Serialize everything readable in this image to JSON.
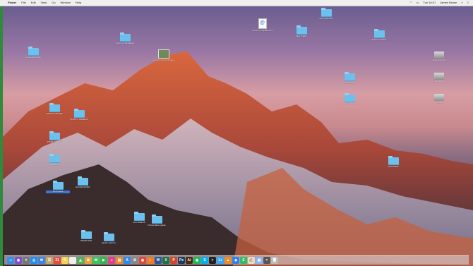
{
  "menubar": {
    "app_name": "Finder",
    "menus": [
      "File",
      "Edit",
      "View",
      "Go",
      "Window",
      "Help"
    ],
    "clock": "Tue 18:07",
    "user": "James Brown"
  },
  "desktop_icons": [
    {
      "kind": "folder",
      "label": "Forms & Templates",
      "color": "#6cc0ee"
    },
    {
      "kind": "folder",
      "label": "Household Files",
      "color": "#6cc0ee"
    },
    {
      "kind": "doc",
      "label": "Lincoln Centre Screen",
      "color": "#ffffff"
    },
    {
      "kind": "web",
      "label": "invoice_template.html",
      "color": "#ffffff"
    },
    {
      "kind": "folder",
      "label": "New Folder",
      "color": "#6cc0ee"
    },
    {
      "kind": "folder",
      "label": "App resources",
      "color": "#6cc0ee"
    },
    {
      "kind": "folder",
      "label": "Images & Ideas",
      "color": "#6cc0ee"
    },
    {
      "kind": "folder",
      "label": "TOOLKIT AS PDF",
      "color": "#6cc0ee"
    },
    {
      "kind": "folder",
      "label": "SUPPLY ORDERS",
      "color": "#6cc0ee"
    },
    {
      "kind": "folder",
      "label": "PRINT AS PDF",
      "color": "#6cc0ee"
    },
    {
      "kind": "folder",
      "label": "Websites",
      "color": "#6cc0ee"
    },
    {
      "kind": "folder",
      "label": "Workspace",
      "color": "#6cc0ee"
    },
    {
      "kind": "folder",
      "label": "ALCOHOLISM",
      "color": "#6cc0ee"
    },
    {
      "kind": "folder",
      "label": "GUI VIDEOS",
      "color": "#6cc0ee"
    },
    {
      "kind": "folder",
      "label": "Presentation guide",
      "color": "#6cc0ee"
    },
    {
      "kind": "folder",
      "label": "PROM DAD",
      "color": "#6cc0ee"
    },
    {
      "kind": "folder",
      "label": "garden planner",
      "color": "#6cc0ee"
    },
    {
      "kind": "folder",
      "label": "Documents",
      "color": "#6cc0ee"
    },
    {
      "kind": "folder",
      "label": "Screenshots",
      "color": "#6cc0ee"
    },
    {
      "kind": "folder",
      "label": "Downloads",
      "color": "#6cc0ee"
    },
    {
      "kind": "drive",
      "label": "Macintosh HD",
      "color": "#cccccc"
    },
    {
      "kind": "drive",
      "label": "BACKUP",
      "color": "#cccccc"
    },
    {
      "kind": "drive",
      "label": "Archive",
      "color": "#cccccc"
    }
  ],
  "dock": {
    "apps": [
      {
        "name": "finder-icon",
        "glyph": "☺",
        "color": "#3b8ee8"
      },
      {
        "name": "siri-icon",
        "glyph": "◉",
        "color": "#7a4fd1"
      },
      {
        "name": "launchpad-icon",
        "glyph": "✦",
        "color": "#777777"
      },
      {
        "name": "safari-icon",
        "glyph": "◎",
        "color": "#1f8ef1"
      },
      {
        "name": "mail-icon",
        "glyph": "✉",
        "color": "#3a86e8"
      },
      {
        "name": "contacts-icon",
        "glyph": "☰",
        "color": "#c7a66a"
      },
      {
        "name": "calendar-icon",
        "glyph": "31",
        "color": "#e64b3b"
      },
      {
        "name": "notes-icon",
        "glyph": "✎",
        "color": "#f6d54a"
      },
      {
        "name": "reminders-icon",
        "glyph": "≡",
        "color": "#eeeeee"
      },
      {
        "name": "maps-icon",
        "glyph": "◭",
        "color": "#55b05a"
      },
      {
        "name": "photos-icon",
        "glyph": "✿",
        "color": "#e9a13b"
      },
      {
        "name": "messages-icon",
        "glyph": "✉",
        "color": "#34c759"
      },
      {
        "name": "facetime-icon",
        "glyph": "▶",
        "color": "#2fb74a"
      },
      {
        "name": "itunes-icon",
        "glyph": "♫",
        "color": "#e23f8a"
      },
      {
        "name": "ibooks-icon",
        "glyph": "▤",
        "color": "#f08a24"
      },
      {
        "name": "appstore-icon",
        "glyph": "A",
        "color": "#2e8af0"
      },
      {
        "name": "preferences-icon",
        "glyph": "⚙",
        "color": "#888888"
      },
      {
        "name": "chrome-icon",
        "glyph": "◍",
        "color": "#e2453c"
      },
      {
        "name": "firefox-icon",
        "glyph": "◐",
        "color": "#f47b20"
      },
      {
        "name": "word-icon",
        "glyph": "W",
        "color": "#2b5797"
      },
      {
        "name": "excel-icon",
        "glyph": "X",
        "color": "#1e7145"
      },
      {
        "name": "powerpoint-icon",
        "glyph": "P",
        "color": "#d24726"
      },
      {
        "name": "photoshop-icon",
        "glyph": "Ps",
        "color": "#1d3a5f"
      },
      {
        "name": "illustrator-icon",
        "glyph": "Ai",
        "color": "#4b2a0f"
      },
      {
        "name": "spotify-icon",
        "glyph": "◉",
        "color": "#1db954"
      },
      {
        "name": "skype-icon",
        "glyph": "S",
        "color": "#00aff0"
      },
      {
        "name": "terminal-icon",
        "glyph": ">",
        "color": "#222222"
      },
      {
        "name": "lightroom-icon",
        "glyph": "Lr",
        "color": "#31a8ff"
      },
      {
        "name": "vlc-icon",
        "glyph": "▲",
        "color": "#f08a24"
      },
      {
        "name": "dropbox-icon",
        "glyph": "◆",
        "color": "#2d81f7"
      },
      {
        "name": "evernote-icon",
        "glyph": "E",
        "color": "#2dbe60"
      },
      {
        "name": "textedit-icon",
        "glyph": "✍",
        "color": "#dddddd"
      },
      {
        "name": "preview-icon",
        "glyph": "▣",
        "color": "#8ab4f8"
      },
      {
        "name": "calculator-icon",
        "glyph": "=",
        "color": "#555555"
      },
      {
        "name": "trash-icon",
        "glyph": "🗑",
        "color": "#bbbbbb"
      }
    ]
  }
}
